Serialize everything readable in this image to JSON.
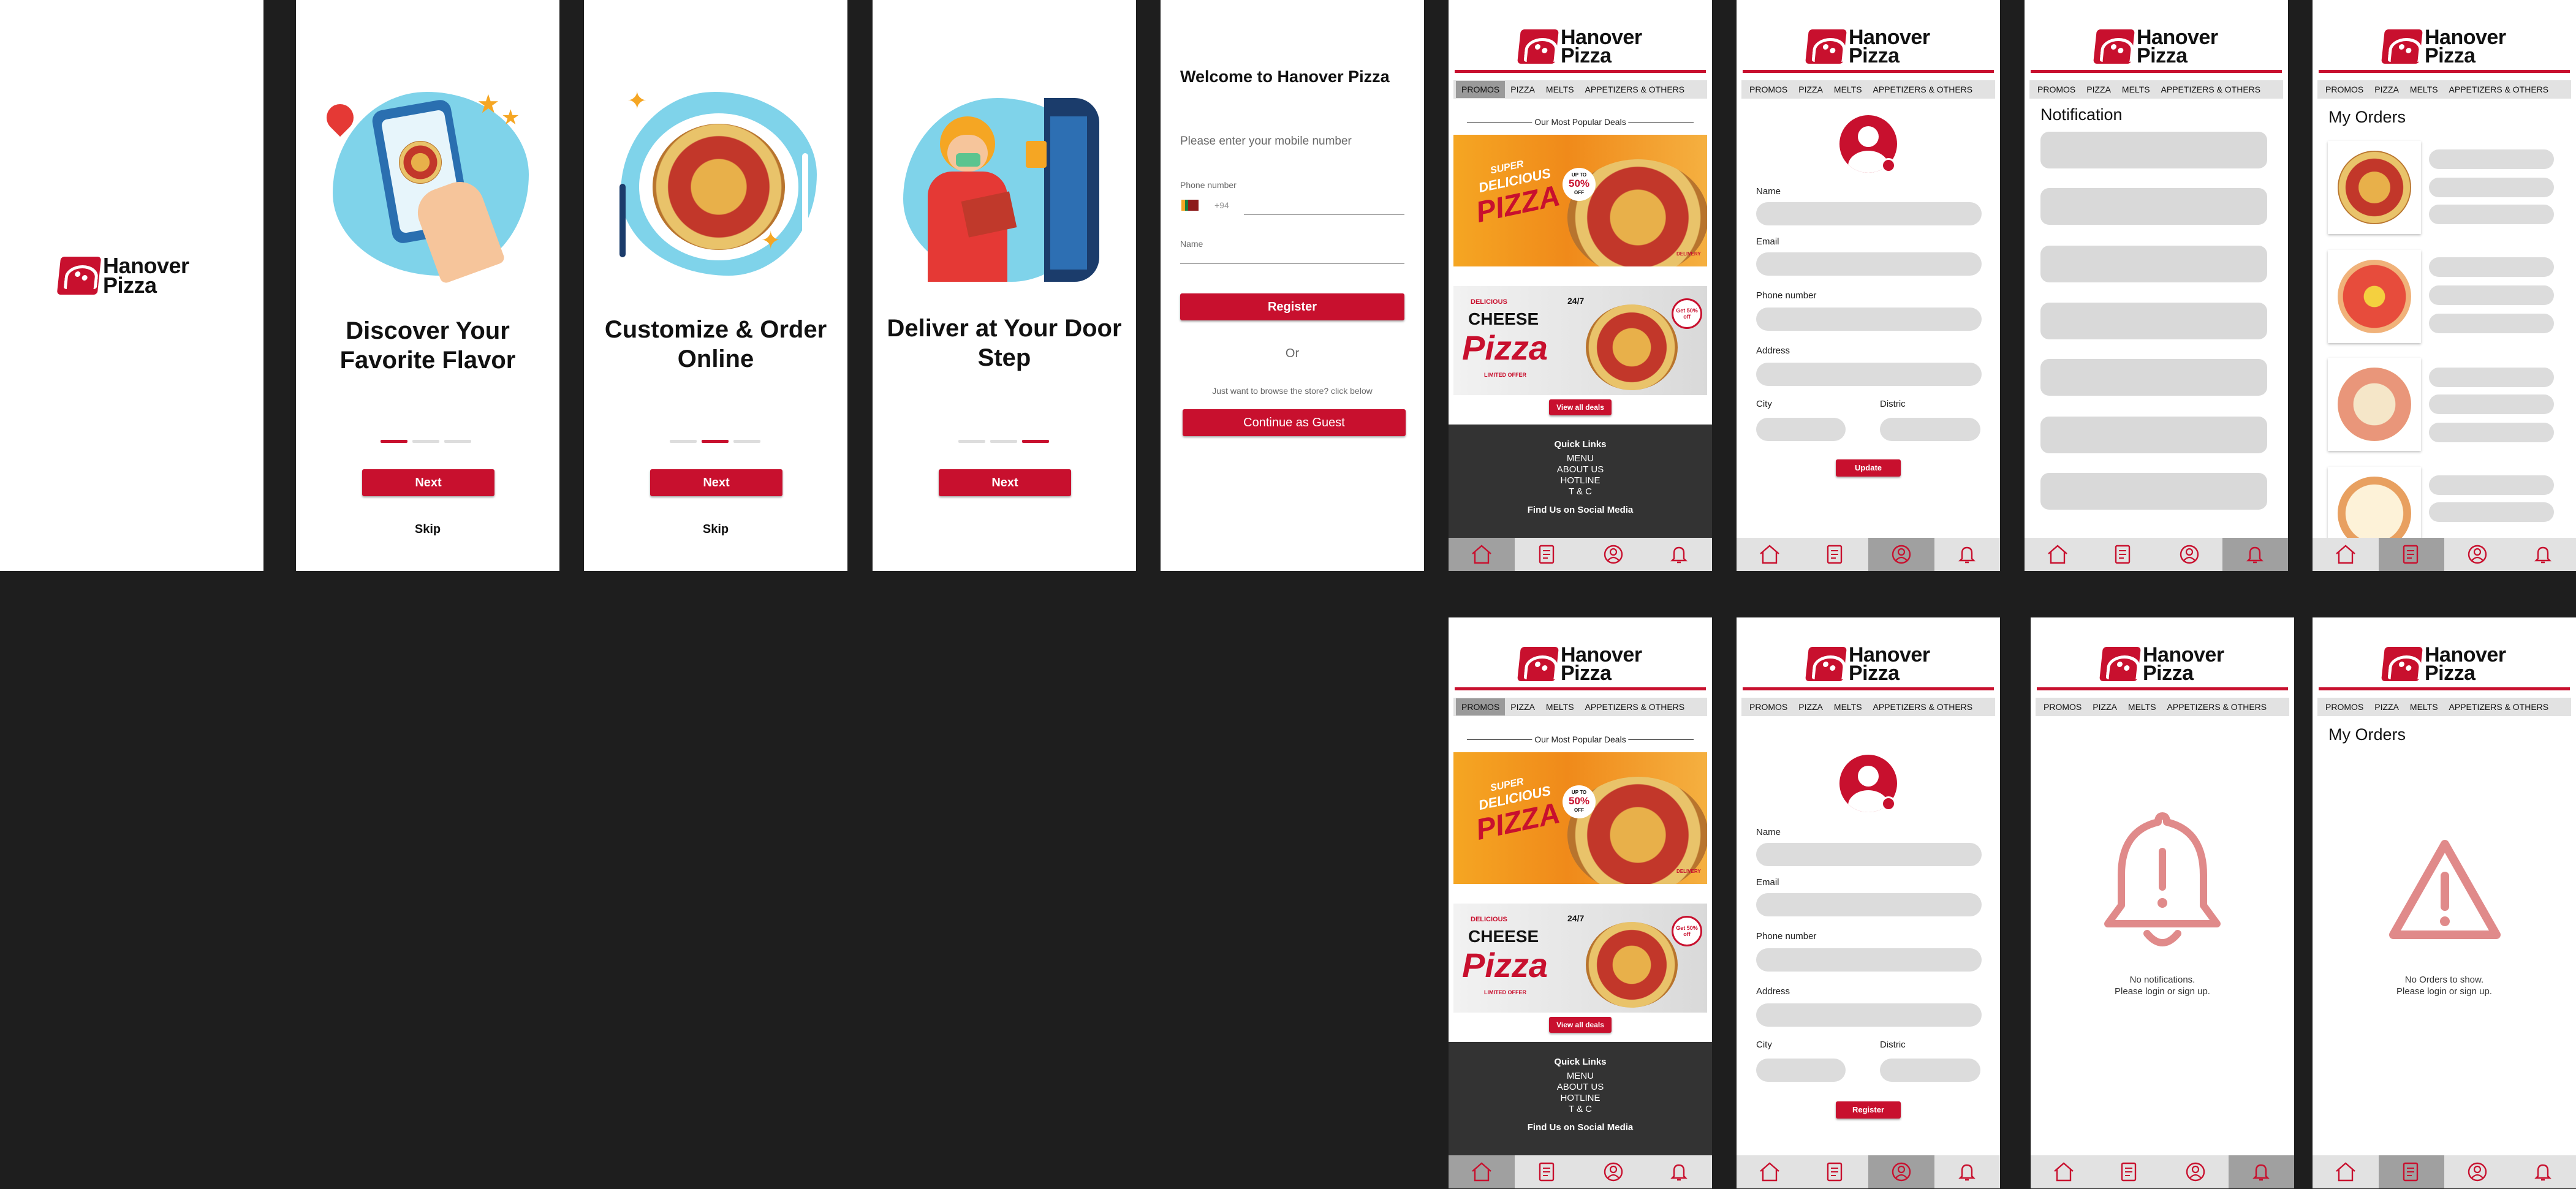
{
  "brand": {
    "line1": "Hanover",
    "line2": "Pizza",
    "red": "#c8102e",
    "dark_bg": "#1e1e1e"
  },
  "onboarding": [
    {
      "title": "Discover Your Favorite Flavor",
      "button": "Next",
      "skip": "Skip"
    },
    {
      "title": "Customize & Order Online",
      "button": "Next",
      "skip": "Skip"
    },
    {
      "title": "Deliver at Your Door Step",
      "button": "Next"
    }
  ],
  "welcome": {
    "title": "Welcome to Hanover Pizza",
    "subtitle": "Please enter your mobile number",
    "phone_label": "Phone number",
    "phone_prefix": "+94",
    "name_label": "Name",
    "register": "Register",
    "or": "Or",
    "browse_text": "Just want to browse the store? click below",
    "guest": "Continue as Guest"
  },
  "menu": [
    "PROMOS",
    "PIZZA",
    "MELTS",
    "APPETIZERS & OTHERS"
  ],
  "home": {
    "deals_title": "Our Most Popular Deals",
    "banner1": {
      "l1": "SUPER",
      "l2": "DELICIOUS",
      "l3": "PIZZA",
      "badge_top": "UP TO",
      "badge": "50%",
      "badge_bot": "OFF",
      "tag": "DELIVERY"
    },
    "banner2": {
      "l1": "DELICIOUS",
      "l2": "CHEESE",
      "l3": "Pizza",
      "l4": "LIMITED OFFER",
      "badge": "24/7",
      "deal": "Get 50% off"
    },
    "view_all": "View all deals",
    "quick_links_title": "Quick Links",
    "links": [
      "MENU",
      "ABOUT US",
      "HOTLINE",
      "T & C"
    ],
    "social": "Find Us on Social Media"
  },
  "profile": {
    "name": "Name",
    "email": "Email",
    "phone": "Phone number",
    "address": "Address",
    "city": "City",
    "district": "Distric",
    "update": "Update",
    "register": "Register"
  },
  "notifications": {
    "title": "Notification",
    "empty_l1": "No notifications.",
    "empty_l2": "Please login or sign up."
  },
  "orders": {
    "title": "My Orders",
    "empty_l1": "No Orders to show.",
    "empty_l2": "Please login or sign up."
  },
  "icons": [
    "home-icon",
    "menu-book-icon",
    "profile-icon",
    "bell-icon"
  ]
}
